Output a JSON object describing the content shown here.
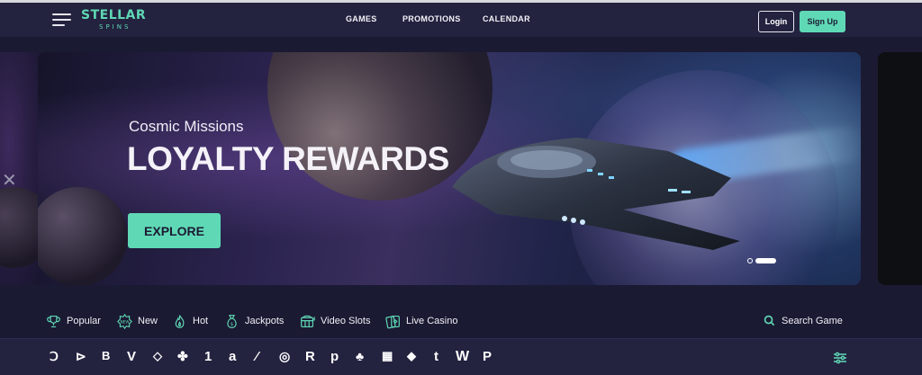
{
  "brand": {
    "name": "STELLAR",
    "tagline": "SPINS",
    "accent": "#5fd9b5",
    "background": "#1b1a33"
  },
  "nav": [
    {
      "label": "GAMES"
    },
    {
      "label": "PROMOTIONS"
    },
    {
      "label": "CALENDAR"
    }
  ],
  "auth": {
    "login_label": "Login",
    "signup_label": "Sign Up"
  },
  "hero": {
    "subtitle": "Cosmic Missions",
    "title": "LOYALTY REWARDS",
    "cta_label": "EXPLORE",
    "slides_total": 2,
    "active_slide": 2
  },
  "categories": [
    {
      "label": "Popular",
      "icon": "trophy-icon"
    },
    {
      "label": "New",
      "icon": "new-badge-icon"
    },
    {
      "label": "Hot",
      "icon": "flame-icon"
    },
    {
      "label": "Jackpots",
      "icon": "money-bag-icon"
    },
    {
      "label": "Video Slots",
      "icon": "slot-machine-icon"
    },
    {
      "label": "Live Casino",
      "icon": "cards-icon"
    }
  ],
  "search": {
    "label": "Search Game",
    "icon": "search-icon"
  },
  "providers": [
    {
      "glyph": "Ↄ",
      "icon": "provider-1-logo"
    },
    {
      "glyph": "⊳",
      "icon": "provider-2-logo"
    },
    {
      "glyph": "B",
      "icon": "provider-3-logo"
    },
    {
      "glyph": "V",
      "icon": "provider-4-logo"
    },
    {
      "glyph": "◇",
      "icon": "provider-5-logo"
    },
    {
      "glyph": "✤",
      "icon": "provider-6-logo"
    },
    {
      "glyph": "1",
      "icon": "provider-7-logo"
    },
    {
      "glyph": "a",
      "icon": "provider-8-logo"
    },
    {
      "glyph": "⁄",
      "icon": "provider-9-logo"
    },
    {
      "glyph": "◎",
      "icon": "provider-10-logo"
    },
    {
      "glyph": "R",
      "icon": "provider-11-logo"
    },
    {
      "glyph": "p",
      "icon": "provider-12-logo"
    },
    {
      "glyph": "♣",
      "icon": "provider-13-logo"
    },
    {
      "glyph": "▦",
      "icon": "provider-14-logo"
    },
    {
      "glyph": "◆",
      "icon": "provider-15-logo"
    },
    {
      "glyph": "t",
      "icon": "provider-16-logo"
    },
    {
      "glyph": "W",
      "icon": "provider-17-logo"
    },
    {
      "glyph": "P",
      "icon": "provider-18-logo"
    }
  ]
}
